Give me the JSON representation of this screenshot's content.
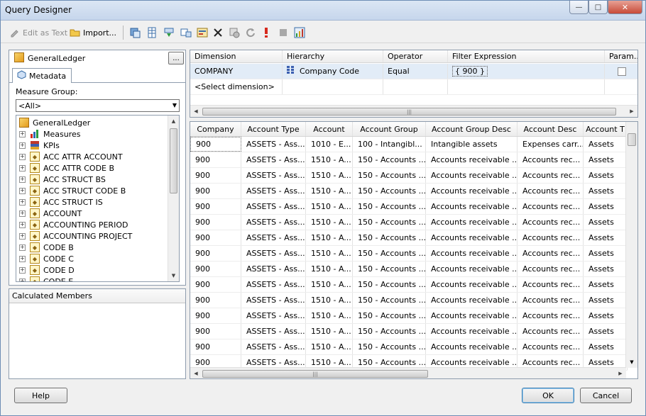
{
  "window": {
    "title": "Query Designer",
    "minimize_glyph": "—",
    "maximize_glyph": "□",
    "close_glyph": "✕"
  },
  "toolbar": {
    "edit_as_text": "Edit as Text",
    "import": "Import...",
    "icons": [
      "add-calculated-member-icon",
      "show-empty-cells-icon",
      "auto-execute-icon",
      "show-aggregations-icon",
      "query-parameters-icon",
      "delete-icon",
      "prepare-query-icon",
      "refresh-icon",
      "run-query-icon",
      "cancel-query-icon",
      "design-mode-icon"
    ]
  },
  "cube": {
    "name": "GeneralLedger",
    "browse_label": "..."
  },
  "metadata_tab": {
    "label": "Metadata"
  },
  "measure_group": {
    "label": "Measure Group:",
    "selected": "<All>"
  },
  "tree": {
    "root": "GeneralLedger",
    "items": [
      {
        "label": "Measures",
        "icon": "measures-icon"
      },
      {
        "label": "KPIs",
        "icon": "kpis-icon"
      },
      {
        "label": "ACC ATTR ACCOUNT",
        "icon": "dimension-icon"
      },
      {
        "label": "ACC ATTR CODE B",
        "icon": "dimension-icon"
      },
      {
        "label": "ACC STRUCT BS",
        "icon": "dimension-icon"
      },
      {
        "label": "ACC STRUCT CODE B",
        "icon": "dimension-icon"
      },
      {
        "label": "ACC STRUCT IS",
        "icon": "dimension-icon"
      },
      {
        "label": "ACCOUNT",
        "icon": "dimension-icon"
      },
      {
        "label": "ACCOUNTING PERIOD",
        "icon": "dimension-icon"
      },
      {
        "label": "ACCOUNTING PROJECT",
        "icon": "dimension-icon"
      },
      {
        "label": "CODE B",
        "icon": "dimension-icon"
      },
      {
        "label": "CODE C",
        "icon": "dimension-icon"
      },
      {
        "label": "CODE D",
        "icon": "dimension-icon"
      },
      {
        "label": "CODE E",
        "icon": "dimension-icon"
      }
    ]
  },
  "calculated_members": {
    "label": "Calculated Members"
  },
  "filter_grid": {
    "columns": [
      "Dimension",
      "Hierarchy",
      "Operator",
      "Filter Expression",
      "Param..."
    ],
    "rows": [
      {
        "dimension": "COMPANY",
        "hierarchy": "Company Code",
        "operator": "Equal",
        "filter_expression": "{ 900 }",
        "parameter": false
      },
      {
        "dimension": "<Select dimension>",
        "hierarchy": "",
        "operator": "",
        "filter_expression": "",
        "parameter": null
      }
    ]
  },
  "results": {
    "columns": [
      "Company",
      "Account Type",
      "Account",
      "Account Group",
      "Account Group Desc",
      "Account Desc",
      "Account T"
    ],
    "rows": [
      [
        "900",
        "ASSETS - Ass...",
        "1010 - E...",
        "100 - Intangibl...",
        "Intangible assets",
        "Expenses carr...",
        "Assets"
      ],
      [
        "900",
        "ASSETS - Ass...",
        "1510 - A...",
        "150 - Accounts ...",
        "Accounts receivable ...",
        "Accounts rec...",
        "Assets"
      ],
      [
        "900",
        "ASSETS - Ass...",
        "1510 - A...",
        "150 - Accounts ...",
        "Accounts receivable ...",
        "Accounts rec...",
        "Assets"
      ],
      [
        "900",
        "ASSETS - Ass...",
        "1510 - A...",
        "150 - Accounts ...",
        "Accounts receivable ...",
        "Accounts rec...",
        "Assets"
      ],
      [
        "900",
        "ASSETS - Ass...",
        "1510 - A...",
        "150 - Accounts ...",
        "Accounts receivable ...",
        "Accounts rec...",
        "Assets"
      ],
      [
        "900",
        "ASSETS - Ass...",
        "1510 - A...",
        "150 - Accounts ...",
        "Accounts receivable ...",
        "Accounts rec...",
        "Assets"
      ],
      [
        "900",
        "ASSETS - Ass...",
        "1510 - A...",
        "150 - Accounts ...",
        "Accounts receivable ...",
        "Accounts rec...",
        "Assets"
      ],
      [
        "900",
        "ASSETS - Ass...",
        "1510 - A...",
        "150 - Accounts ...",
        "Accounts receivable ...",
        "Accounts rec...",
        "Assets"
      ],
      [
        "900",
        "ASSETS - Ass...",
        "1510 - A...",
        "150 - Accounts ...",
        "Accounts receivable ...",
        "Accounts rec...",
        "Assets"
      ],
      [
        "900",
        "ASSETS - Ass...",
        "1510 - A...",
        "150 - Accounts ...",
        "Accounts receivable ...",
        "Accounts rec...",
        "Assets"
      ],
      [
        "900",
        "ASSETS - Ass...",
        "1510 - A...",
        "150 - Accounts ...",
        "Accounts receivable ...",
        "Accounts rec...",
        "Assets"
      ],
      [
        "900",
        "ASSETS - Ass...",
        "1510 - A...",
        "150 - Accounts ...",
        "Accounts receivable ...",
        "Accounts rec...",
        "Assets"
      ],
      [
        "900",
        "ASSETS - Ass...",
        "1510 - A...",
        "150 - Accounts ...",
        "Accounts receivable ...",
        "Accounts rec...",
        "Assets"
      ],
      [
        "900",
        "ASSETS - Ass...",
        "1510 - A...",
        "150 - Accounts ...",
        "Accounts receivable ...",
        "Accounts rec...",
        "Assets"
      ],
      [
        "900",
        "ASSETS - Ass...",
        "1510 - A...",
        "150 - Accounts ...",
        "Accounts receivable ...",
        "Accounts rec...",
        "Assets"
      ]
    ]
  },
  "footer": {
    "help": "Help",
    "ok": "OK",
    "cancel": "Cancel"
  }
}
